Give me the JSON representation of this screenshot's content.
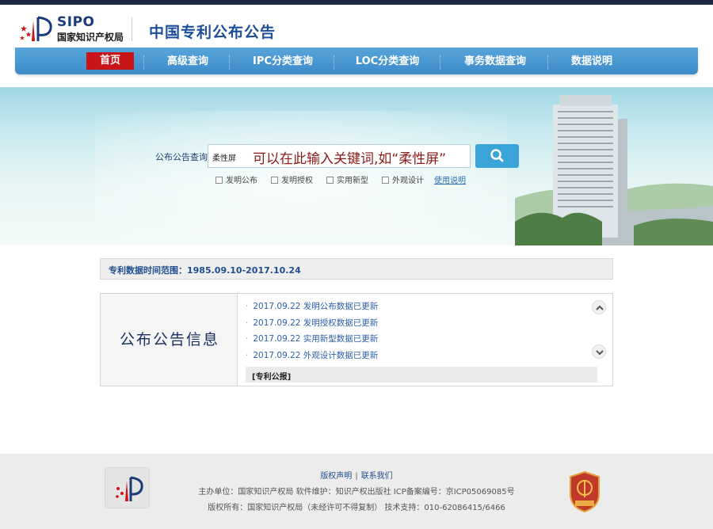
{
  "header": {
    "logo_en": "SIPO",
    "logo_cn": "国家知识产权局",
    "site_title": "中国专利公布公告"
  },
  "nav": {
    "items": [
      {
        "label": "首页",
        "active": true
      },
      {
        "label": "高级查询",
        "active": false
      },
      {
        "label": "IPC分类查询",
        "active": false
      },
      {
        "label": "LOC分类查询",
        "active": false
      },
      {
        "label": "事务数据查询",
        "active": false
      },
      {
        "label": "数据说明",
        "active": false
      }
    ]
  },
  "search": {
    "label": "公布公告查询",
    "value": "柔性屏",
    "hint": "可以在此输入关键词,如“柔性屏”",
    "options": [
      {
        "label": "发明公布",
        "checked": false
      },
      {
        "label": "发明授权",
        "checked": false
      },
      {
        "label": "实用新型",
        "checked": false
      },
      {
        "label": "外观设计",
        "checked": false
      }
    ],
    "help_link": "使用说明"
  },
  "data_range": "专利数据时间范围：1985.09.10-2017.10.24",
  "info": {
    "title": "公布公告信息",
    "news": [
      "2017.09.22 发明公布数据已更新",
      "2017.09.22 发明授权数据已更新",
      "2017.09.22 实用新型数据已更新",
      "2017.09.22 外观设计数据已更新"
    ],
    "gazette": "[专利公报]"
  },
  "footer": {
    "link_copyright": "版权声明",
    "link_contact": "联系我们",
    "line1": "主办单位：国家知识产权局    软件维护：知识产权出版社    ICP备案编号：京ICP05069085号",
    "line2": "版权所有：国家知识产权局（未经许可不得复制）    技术支持：010-62086415/6466"
  },
  "colors": {
    "nav_bg": "#3c8bc9",
    "nav_active": "#c91419",
    "title_blue": "#1d4e9a",
    "hint_red": "#8b1a1a",
    "search_button": "#3ba4d8"
  }
}
